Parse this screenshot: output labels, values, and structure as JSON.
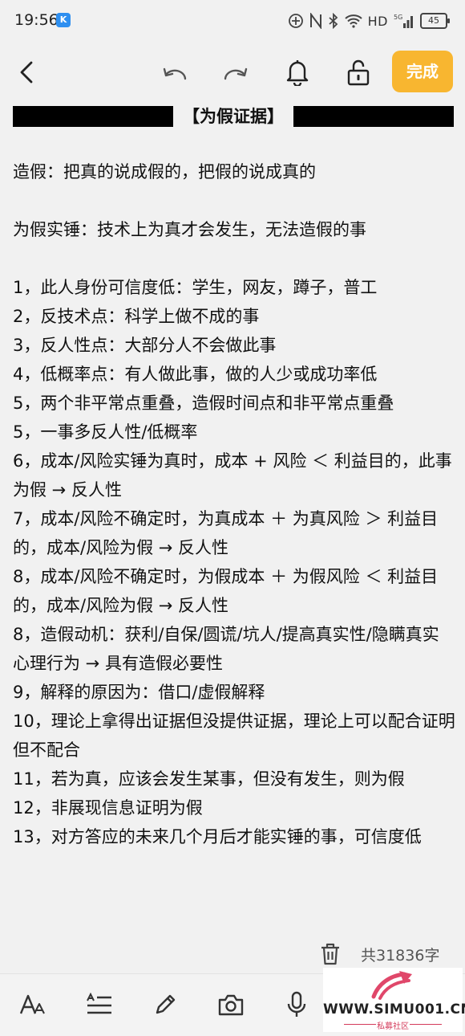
{
  "status_bar": {
    "time": "19:56",
    "app_badge": "K",
    "network": "HD",
    "signal_label": "5G",
    "battery": "45"
  },
  "toolbar": {
    "done_label": "完成",
    "accent_color": "#f8b630"
  },
  "note": {
    "title": "【为假证据】",
    "definitions": [
      "造假：把真的说成假的，把假的说成真的",
      "为假实锤：技术上为真才会发生，无法造假的事"
    ],
    "items": [
      "1，此人身份可信度低：学生，网友，蹲子，普工",
      "2，反技术点：科学上做不成的事",
      "3，反人性点：大部分人不会做此事",
      "4，低概率点：有人做此事，做的人少或成功率低",
      "5，两个非平常点重叠，造假时间点和非平常点重叠",
      "5，一事多反人性/低概率",
      "6，成本/风险实锤为真时，成本 + 风险 ＜ 利益目的，此事为假 → 反人性",
      "7，成本/风险不确定时，为真成本 ＋ 为真风险 ＞ 利益目的，成本/风险为假 → 反人性",
      "8，成本/风险不确定时，为假成本 ＋ 为假风险 ＜ 利益目的，成本/风险为假 → 反人性",
      "8，造假动机：获利/自保/圆谎/坑人/提高真实性/隐瞒真实心理行为 → 具有造假必要性",
      "9，解释的原因为：借口/虚假解释",
      "10，理论上拿得出证据但没提供证据，理论上可以配合证明但不配合",
      "11，若为真，应该会发生某事，但没有发生，则为假",
      "12，非展现信息证明为假",
      "13，对方答应的未来几个月后才能实锤的事，可信度低"
    ],
    "word_count": "共31836字"
  },
  "watermark": {
    "url": "WWW.SIMU001.CN",
    "subtitle": "私募社区"
  }
}
